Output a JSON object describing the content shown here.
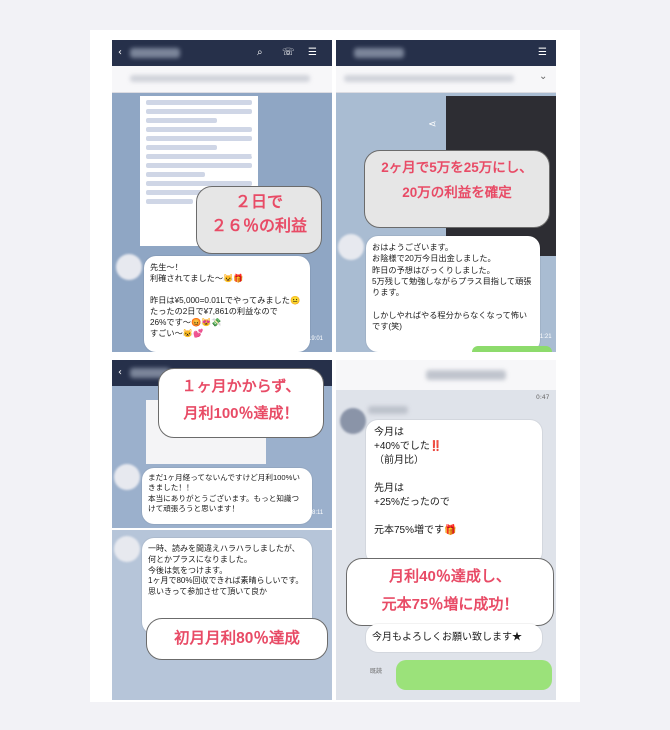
{
  "panels": {
    "p1": {
      "callout": "２日で\n２６％の利益",
      "bubble": "先生～！\n利確されてました～😺🎁\n\n昨日は¥5,000=0.01Lでやってみました😐\nたったの2日で¥7,861の利益なので\n26%です～😡😻💸\nすごい～😺💕",
      "time": "19:01"
    },
    "p2": {
      "callout": "2ヶ月で5万を25万にし、\n20万の利益を確定",
      "bubble": "おはようございます。\nお陰様で20万今日出金しました。\n昨日の予想はびっくりしました。\n5万残して勉強しながらプラス目指して頑張ります。\n\nしかしやればやる程分からなくなって怖いです(笑)",
      "time": "11:21"
    },
    "p3": {
      "callout": "１ヶ月かからず、\n月利100％達成！",
      "bubble": "まだ1ヶ月経ってないんですけど月利100%いきました！！\n本当にありがとうございます。もっと知識つけて頑張ろうと思います！",
      "time": "8:11"
    },
    "p4": {
      "callout": "初月月利80％達成",
      "bubble": "一時、読みを間違えハラハラしましたが、何とかプラスになりました。\n今後は気をつけます。\n1ヶ月で80%回収できれば素晴らしいです。\n思いきって参加させて頂いて良か"
    },
    "p5": {
      "callout": "月利40％達成し、\n元本75％増に成功！",
      "bubble": "今月は\n+40%でした‼️\n（前月比）\n\n先月は\n+25%だったので\n\n元本75%増です🎁",
      "bubble2": "今月もよろしくお願い致します★",
      "read": "既読",
      "time": "0:47"
    }
  },
  "colors": {
    "accent": "#e84b66",
    "line_blue": "#8fa6c4",
    "header": "#26304a",
    "green": "#8ddb6c"
  }
}
